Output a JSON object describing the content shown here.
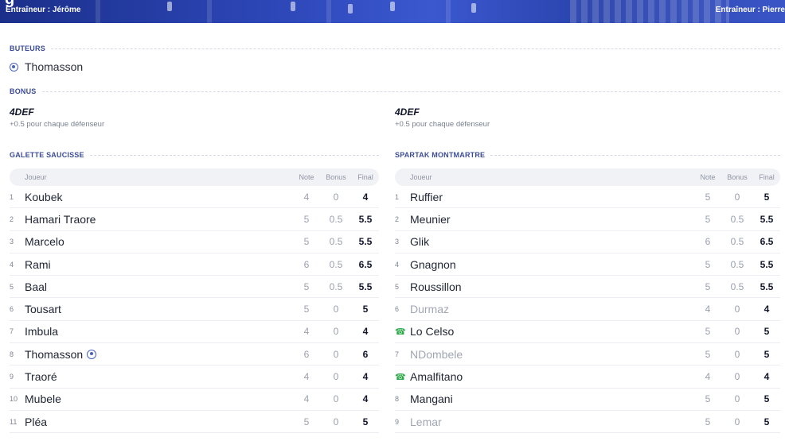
{
  "header": {
    "partial_glyph": "g",
    "coach_left": "Entraîneur : Jérôme",
    "coach_right": "Entraîneur : Pierre"
  },
  "scorers": {
    "title": "BUTEURS",
    "items": [
      {
        "name": "Thomasson",
        "icon": "soccer-ball-icon"
      }
    ]
  },
  "bonus": {
    "title": "BONUS",
    "left": {
      "name": "4DEF",
      "desc": "+0.5 pour chaque défenseur"
    },
    "right": {
      "name": "4DEF",
      "desc": "+0.5 pour chaque défenseur"
    }
  },
  "columns": {
    "player": "Joueur",
    "note": "Note",
    "bonus": "Bonus",
    "final": "Final"
  },
  "colors": {
    "accent": "#3c4c97",
    "substitute_icon": "#2ea84a",
    "banner": "#2d47b8"
  },
  "teams": [
    {
      "name": "GALETTE SAUCISSE",
      "rows": [
        {
          "num": "1",
          "name": "Koubek",
          "note": "4",
          "bonus": "0",
          "final": "4"
        },
        {
          "num": "2",
          "name": "Hamari Traore",
          "note": "5",
          "bonus": "0.5",
          "final": "5.5"
        },
        {
          "num": "3",
          "name": "Marcelo",
          "note": "5",
          "bonus": "0.5",
          "final": "5.5"
        },
        {
          "num": "4",
          "name": "Rami",
          "note": "6",
          "bonus": "0.5",
          "final": "6.5"
        },
        {
          "num": "5",
          "name": "Baal",
          "note": "5",
          "bonus": "0.5",
          "final": "5.5"
        },
        {
          "num": "6",
          "name": "Tousart",
          "note": "5",
          "bonus": "0",
          "final": "5"
        },
        {
          "num": "7",
          "name": "Imbula",
          "note": "4",
          "bonus": "0",
          "final": "4"
        },
        {
          "num": "8",
          "name": "Thomasson",
          "note": "6",
          "bonus": "0",
          "final": "6",
          "goal": true
        },
        {
          "num": "9",
          "name": "Traoré",
          "note": "4",
          "bonus": "0",
          "final": "4"
        },
        {
          "num": "10",
          "name": "Mubele",
          "note": "4",
          "bonus": "0",
          "final": "4"
        },
        {
          "num": "11",
          "name": "Pléa",
          "note": "5",
          "bonus": "0",
          "final": "5"
        }
      ]
    },
    {
      "name": "SPARTAK MONTMARTRE",
      "rows": [
        {
          "num": "1",
          "name": "Ruffier",
          "note": "5",
          "bonus": "0",
          "final": "5"
        },
        {
          "num": "2",
          "name": "Meunier",
          "note": "5",
          "bonus": "0.5",
          "final": "5.5"
        },
        {
          "num": "3",
          "name": "Glik",
          "note": "6",
          "bonus": "0.5",
          "final": "6.5"
        },
        {
          "num": "4",
          "name": "Gnagnon",
          "note": "5",
          "bonus": "0.5",
          "final": "5.5"
        },
        {
          "num": "5",
          "name": "Roussillon",
          "note": "5",
          "bonus": "0.5",
          "final": "5.5"
        },
        {
          "num": "6",
          "name": "Durmaz",
          "note": "4",
          "bonus": "0",
          "final": "4",
          "sub_out": true
        },
        {
          "num": "",
          "name": "Lo Celso",
          "note": "5",
          "bonus": "0",
          "final": "5",
          "sub_in": true
        },
        {
          "num": "7",
          "name": "NDombele",
          "note": "5",
          "bonus": "0",
          "final": "5",
          "sub_out": true
        },
        {
          "num": "",
          "name": "Amalfitano",
          "note": "4",
          "bonus": "0",
          "final": "4",
          "sub_in": true
        },
        {
          "num": "8",
          "name": "Mangani",
          "note": "5",
          "bonus": "0",
          "final": "5"
        },
        {
          "num": "9",
          "name": "Lemar",
          "note": "5",
          "bonus": "0",
          "final": "5",
          "sub_out": true
        }
      ]
    }
  ]
}
